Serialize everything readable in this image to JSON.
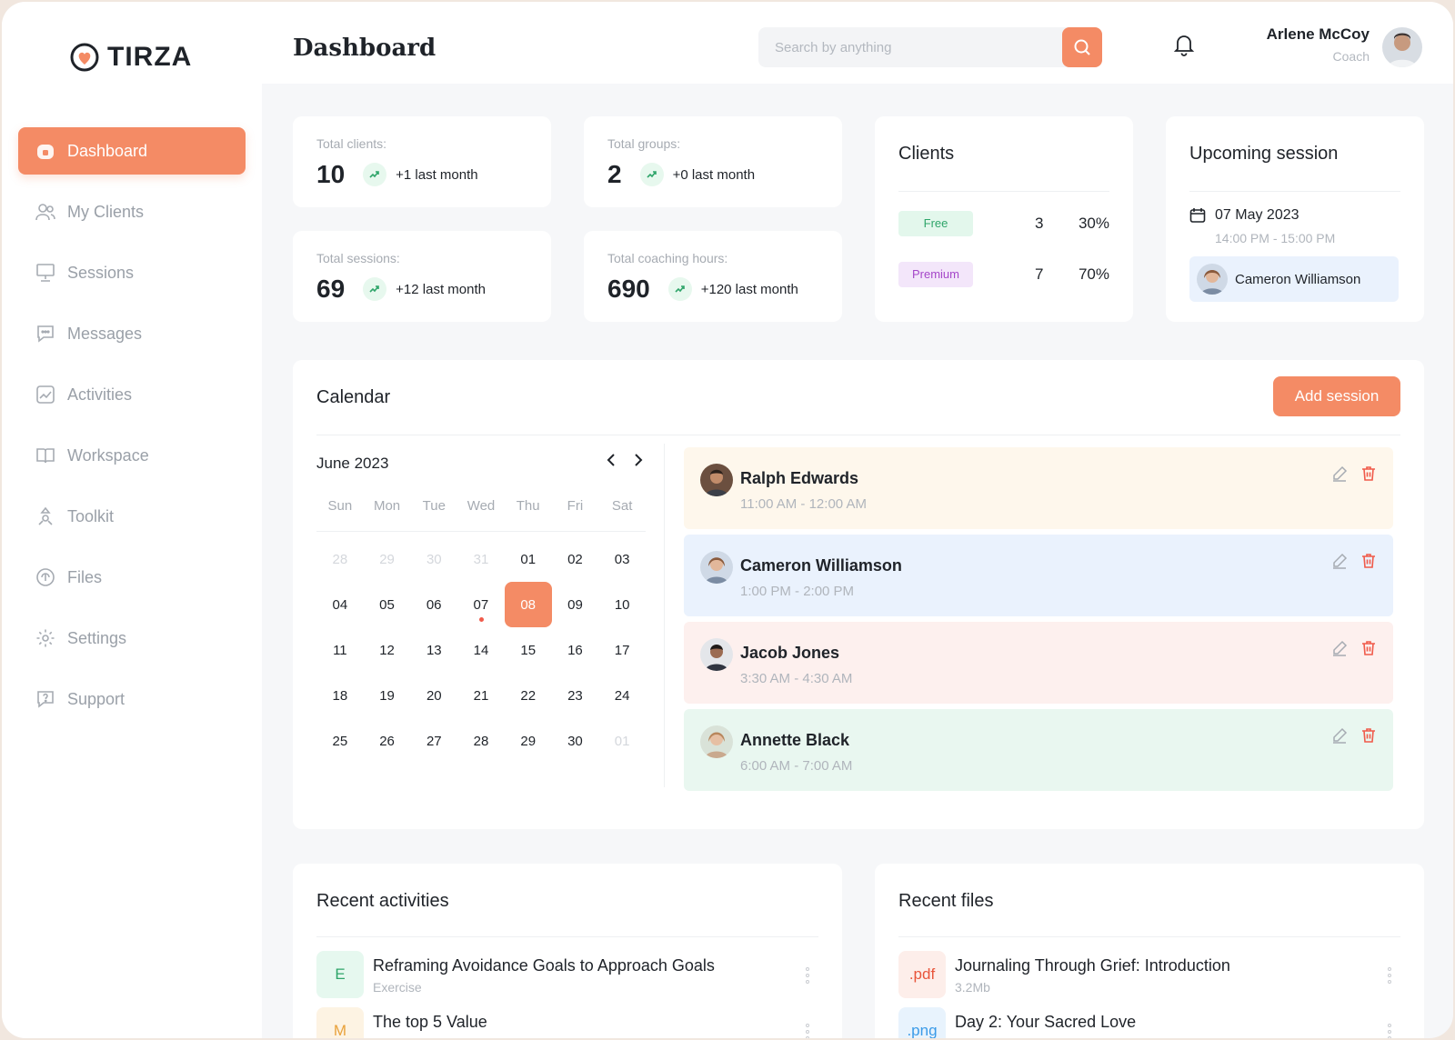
{
  "app": {
    "name": "TIRZA",
    "brand_color": "#f48b65"
  },
  "sidebar": {
    "items": [
      {
        "label": "Dashboard",
        "icon": "home-icon",
        "active": true
      },
      {
        "label": "My Clients",
        "icon": "users-icon"
      },
      {
        "label": "Sessions",
        "icon": "presentation-icon"
      },
      {
        "label": "Messages",
        "icon": "message-icon"
      },
      {
        "label": "Activities",
        "icon": "chart-icon"
      },
      {
        "label": "Workspace",
        "icon": "book-icon"
      },
      {
        "label": "Toolkit",
        "icon": "toolkit-icon"
      },
      {
        "label": "Files",
        "icon": "files-icon"
      },
      {
        "label": "Settings",
        "icon": "gear-icon"
      },
      {
        "label": "Support",
        "icon": "support-icon"
      }
    ]
  },
  "header": {
    "title": "Dashboard",
    "search_placeholder": "Search by anything",
    "user": {
      "name": "Arlene McCoy",
      "role": "Coach"
    }
  },
  "stats": [
    {
      "label": "Total clients:",
      "value": "10",
      "delta": "+1 last month"
    },
    {
      "label": "Total groups:",
      "value": "2",
      "delta": "+0 last month"
    },
    {
      "label": "Total sessions:",
      "value": "69",
      "delta": "+12 last month"
    },
    {
      "label": "Total coaching hours:",
      "value": "690",
      "delta": "+120 last month"
    }
  ],
  "clients": {
    "title": "Clients",
    "rows": [
      {
        "tier": "Free",
        "count": "3",
        "percent": "30%",
        "color": "#2fa56a",
        "bg": "#e3f7ec"
      },
      {
        "tier": "Premium",
        "count": "7",
        "percent": "70%",
        "color": "#a547c9",
        "bg": "#f3e6fa"
      }
    ]
  },
  "upcoming": {
    "title": "Upcoming session",
    "date": "07 May 2023",
    "time": "14:00 PM - 15:00 PM",
    "client": "Cameron Williamson"
  },
  "calendar": {
    "title": "Calendar",
    "add_label": "Add session",
    "month": "June 2023",
    "weekdays": [
      "Sun",
      "Mon",
      "Tue",
      "Wed",
      "Thu",
      "Fri",
      "Sat"
    ],
    "weeks": [
      [
        "28",
        "29",
        "30",
        "31",
        "01",
        "02",
        "03"
      ],
      [
        "04",
        "05",
        "06",
        "07",
        "08",
        "09",
        "10"
      ],
      [
        "11",
        "12",
        "13",
        "14",
        "15",
        "16",
        "17"
      ],
      [
        "18",
        "19",
        "20",
        "21",
        "22",
        "23",
        "24"
      ],
      [
        "25",
        "26",
        "27",
        "28",
        "29",
        "30",
        "01"
      ]
    ],
    "sessions": [
      {
        "name": "Ralph Edwards",
        "time": "11:00 AM - 12:00 AM",
        "bg": "#fef7ec"
      },
      {
        "name": "Cameron Williamson",
        "time": "1:00 PM - 2:00 PM",
        "bg": "#eaf2fd"
      },
      {
        "name": "Jacob Jones",
        "time": "3:30 AM - 4:30 AM",
        "bg": "#fdf0ee"
      },
      {
        "name": "Annette Black",
        "time": "6:00 AM - 7:00 AM",
        "bg": "#e9f7f0"
      }
    ]
  },
  "activities": {
    "title": "Recent activities",
    "items": [
      {
        "badge": "E",
        "title": "Reframing Avoidance Goals to Approach Goals",
        "sub": "Exercise",
        "color": "#2fa56a",
        "bg": "#e6f8ef"
      },
      {
        "badge": "M",
        "title": "The top 5 Value",
        "sub": "",
        "color": "#e9a23b",
        "bg": "#fdf3e3"
      }
    ]
  },
  "files": {
    "title": "Recent files",
    "items": [
      {
        "badge": ".pdf",
        "title": "Journaling Through Grief: Introduction",
        "sub": "3.2Mb",
        "color": "#e8553b",
        "bg": "#fdeeea"
      },
      {
        "badge": ".png",
        "title": "Day 2: Your Sacred Love",
        "sub": "",
        "color": "#3b9be8",
        "bg": "#e8f3fd"
      }
    ]
  }
}
